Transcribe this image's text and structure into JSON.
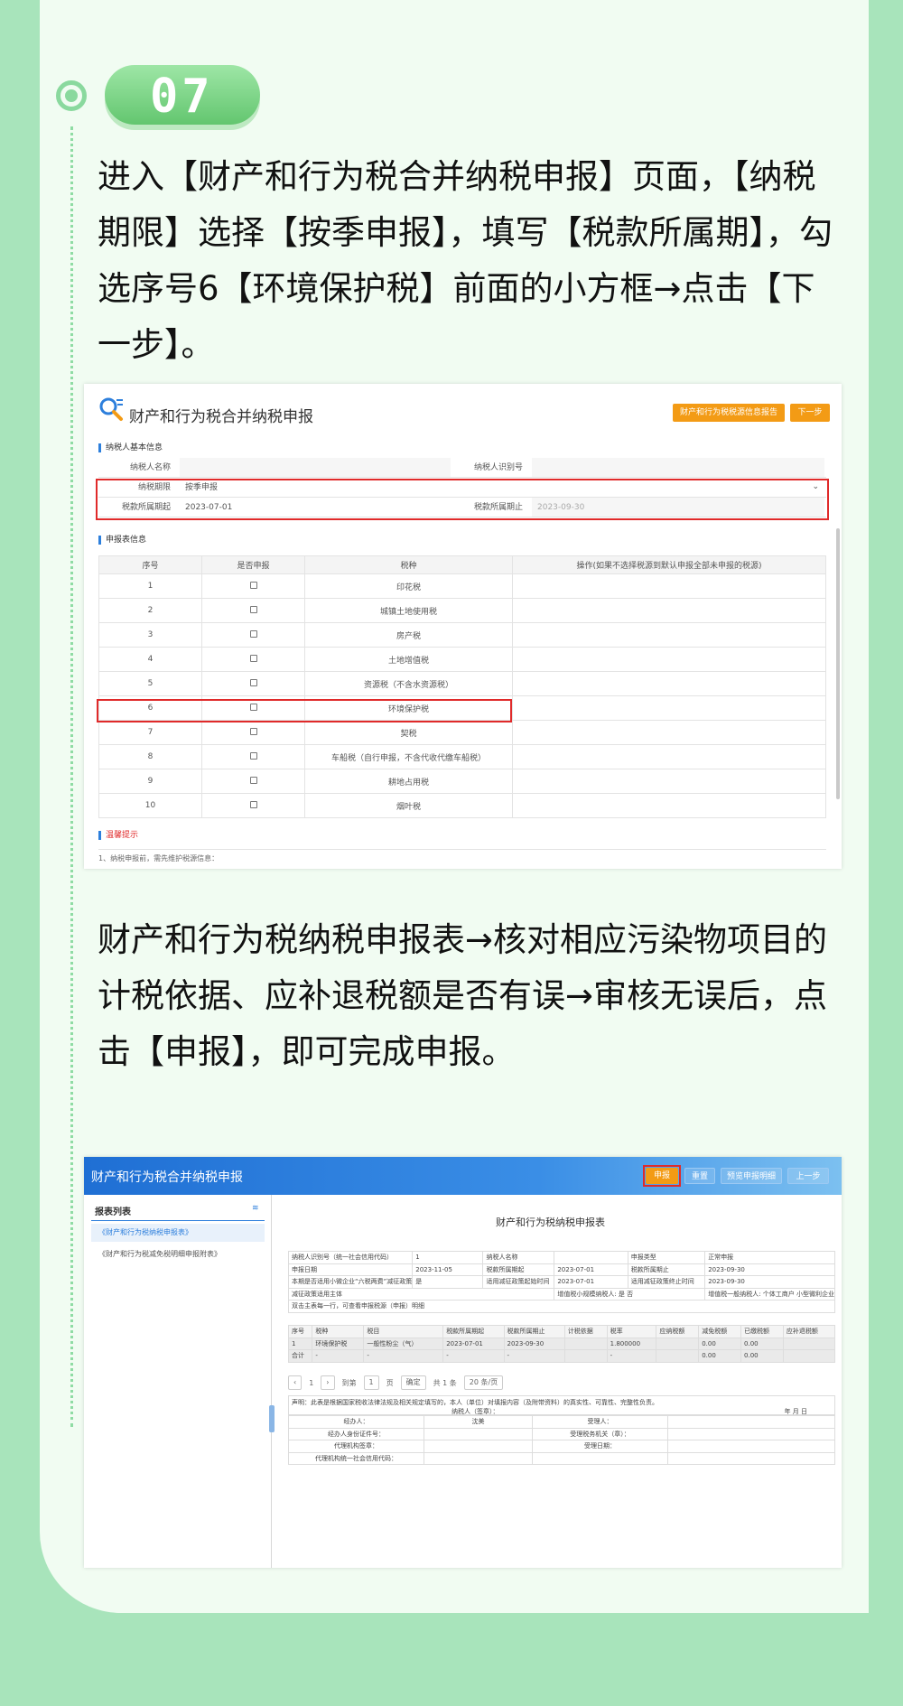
{
  "step": {
    "number": "07"
  },
  "para1": "进入【财产和行为税合并纳税申报】页面，【纳税期限】选择【按季申报】，填写【税款所属期】，勾选序号6【环境保护税】前面的小方框→点击【下一步】。",
  "para2": "财产和行为税纳税申报表→核对相应污染物项目的计税依据、应补退税额是否有误→审核无误后，点击【申报】，即可完成申报。",
  "shot1": {
    "title": "财产和行为税合并纳税申报",
    "btn_info": "财产和行为税税源信息报告",
    "btn_next": "下一步",
    "sec_basic": "纳税人基本信息",
    "name_label": "纳税人名称",
    "id_label": "纳税人识别号",
    "period_label": "纳税期限",
    "period_value": "按季申报",
    "start_label": "税款所属期起",
    "start_value": "2023-07-01",
    "end_label": "税款所属期止",
    "end_value": "2023-09-30",
    "sec_form": "申报表信息",
    "headers": [
      "序号",
      "是否申报",
      "税种",
      "操作(如果不选择税源到默认申报全部未申报的税源)"
    ],
    "rows": [
      {
        "no": "1",
        "tax": "印花税"
      },
      {
        "no": "2",
        "tax": "城镇土地使用税"
      },
      {
        "no": "3",
        "tax": "房产税"
      },
      {
        "no": "4",
        "tax": "土地增值税"
      },
      {
        "no": "5",
        "tax": "资源税（不含水资源税）"
      },
      {
        "no": "6",
        "tax": "环境保护税"
      },
      {
        "no": "7",
        "tax": "契税"
      },
      {
        "no": "8",
        "tax": "车船税（自行申报，不含代收代缴车船税）"
      },
      {
        "no": "9",
        "tax": "耕地占用税"
      },
      {
        "no": "10",
        "tax": "烟叶税"
      }
    ],
    "tip_title": "温馨提示",
    "tip_text": "1、纳税申报前，需先维护税源信息："
  },
  "shot2": {
    "title": "财产和行为税合并纳税申报",
    "btn_declare": "申报",
    "btn_reset": "重置",
    "btn_preview": "预览申报明细",
    "btn_prev": "上一步",
    "side_head": "报表列表",
    "side_item1": "《财产和行为税纳税申报表》",
    "side_item2": "《财产和行为税减免税明细申报附表》",
    "form_title": "财产和行为税纳税申报表",
    "info": {
      "r1": [
        "纳税人识别号（统一社会信用代码）",
        "1",
        "纳税人名称",
        "",
        "申报类型",
        "正常申报"
      ],
      "r2": [
        "申报日期",
        "2023-11-05",
        "税款所属期起",
        "2023-07-01",
        "税款所属期止",
        "2023-09-30"
      ],
      "r3": [
        "本期是否适用小微企业“六税两费”减征政策",
        "是",
        "适用减征政策起始时间",
        "2023-07-01",
        "适用减征政策终止时间",
        "2023-09-30"
      ],
      "r4a": "减征政策适用主体",
      "r4b": "增值税小规模纳税人: 是  否",
      "r4c": "增值税一般纳税人: 个体工商户  小型微利企业",
      "r5": "双击主表每一行，可查看申报税源（申报）明细",
      "headers": [
        "序号",
        "税种",
        "税目",
        "税款所属期起",
        "税款所属期止",
        "计税依据",
        "税率",
        "应纳税额",
        "减免税额",
        "已缴税额",
        "应补退税额"
      ],
      "row1": [
        "1",
        "环境保护税",
        "一般性粉尘（气）",
        "2023-07-01",
        "2023-09-30",
        "",
        "1.800000",
        "",
        "0.00",
        "0.00",
        ""
      ],
      "total": [
        "合计",
        "-",
        "-",
        "-",
        "-",
        "",
        "-",
        "",
        "0.00",
        "0.00",
        ""
      ]
    },
    "pager": {
      "page": "1",
      "goto": "到第",
      "page_input": "1",
      "page_unit": "页",
      "confirm": "确定",
      "total": "共 1 条",
      "per": "20 条/页"
    },
    "decl": "声明：此表是根据国家税收法律法规及相关规定填写的，本人（单位）对填报内容（及附带资料）的真实性、可靠性、完整性负责。",
    "decl_sign": "纳税人（签章）：",
    "decl_date": "年      月      日",
    "bottom": [
      [
        "经办人：",
        "沈美",
        "受理人：",
        ""
      ],
      [
        "经办人身份证件号：",
        "",
        "受理税务机关（章）：",
        ""
      ],
      [
        "代理机构签章：",
        "",
        "受理日期：",
        ""
      ],
      [
        "代理机构统一社会信用代码：",
        "",
        "",
        ""
      ]
    ]
  }
}
